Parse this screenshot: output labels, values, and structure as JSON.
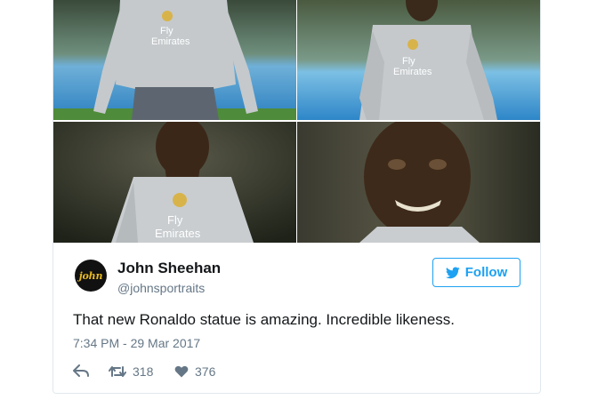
{
  "tweet": {
    "author_name": "John Sheehan",
    "author_handle": "@johnsportraits",
    "avatar_text": "john",
    "follow_label": "Follow",
    "text": "That new Ronaldo statue is amazing. Incredible likeness.",
    "timestamp": "7:34 PM - 29 Mar 2017",
    "retweet_count": "318",
    "like_count": "376"
  },
  "photos": {
    "shirt_text_1": "Fly",
    "shirt_text_2": "Emirates"
  },
  "colors": {
    "twitter_blue": "#1da1f2",
    "muted_text": "#657786",
    "border": "#e1e8ed"
  }
}
